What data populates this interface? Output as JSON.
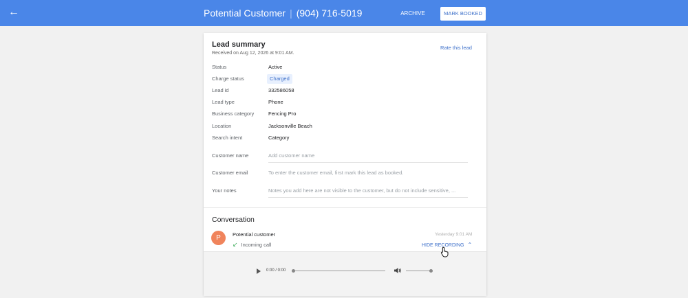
{
  "header": {
    "back_icon": "arrow-left-icon",
    "contact_name": "Potential Customer",
    "separator": "|",
    "phone": "(904) 716-5019",
    "archive_label": "ARCHIVE",
    "mark_booked_label": "MARK BOOKED",
    "bar_color": "#4a86e8"
  },
  "lead": {
    "title": "Lead summary",
    "received": "Received on Aug 12, 2026 at 9:01 AM.",
    "rate_link": "Rate this lead",
    "fields": [
      {
        "label": "Status",
        "value": "Active"
      },
      {
        "label": "Charge status",
        "value": "Charged"
      },
      {
        "label": "Lead id",
        "value": "332586058"
      },
      {
        "label": "Lead type",
        "value": "Phone"
      },
      {
        "label": "Business category",
        "value": "Fencing Pro"
      },
      {
        "label": "Location",
        "value": "Jacksonville Beach"
      },
      {
        "label": "Search intent",
        "value": "Category"
      }
    ],
    "customer_name": {
      "label": "Customer name",
      "placeholder": "Add customer name"
    },
    "customer_email": {
      "label": "Customer email",
      "placeholder": "To enter the customer email, first mark this lead as booked."
    },
    "notes": {
      "label": "Your notes",
      "placeholder": "Notes you add here are not visible to the customer, but do not include sensitive, ..."
    }
  },
  "conversation": {
    "title": "Conversation",
    "avatar_letter": "P",
    "avatar_color": "#f0845c",
    "caller": "Potential customer",
    "call_type": "Incoming call",
    "call_icon": "incoming-call-arrow-icon",
    "timestamp": "Yesterday 9:01 AM",
    "hide_recording": "HIDE RECORDING",
    "chevron_icon": "chevron-up-icon"
  },
  "player": {
    "time": "0:00 / 0:00",
    "play_icon": "play-icon",
    "volume_icon": "volume-icon"
  }
}
